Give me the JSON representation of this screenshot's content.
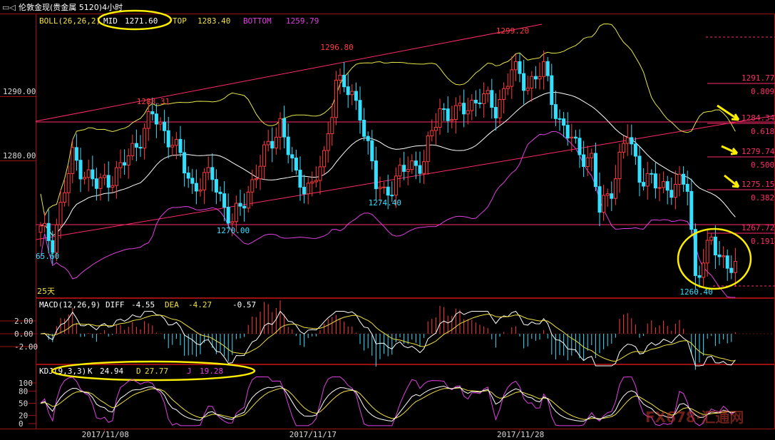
{
  "colors": {
    "up": "#ff3b3b",
    "down": "#33e0ff",
    "mid": "#ffffff",
    "band": "#e6e64a",
    "bottom": "#e040e0",
    "trend": "#ff2a6a",
    "fib": "#ff2a6a",
    "grid": "#8b1010",
    "axis": "#9a0f0f",
    "highlight": "#ffee00",
    "kdj_k": "#ffffff",
    "kdj_d": "#f0e040",
    "kdj_j": "#e040e0",
    "tick": "#d8d8d8"
  },
  "header": {
    "title": "伦敦金现(贵金属 5120)4小时"
  },
  "boll": {
    "label": "BOLL(26,26,2)",
    "mid_label": "MID",
    "mid_value": "1271.60",
    "top_label": "TOP",
    "top_value": "1283.40",
    "bottom_label": "BOTTOM",
    "bottom_value": "1259.79"
  },
  "macd": {
    "label": "MACD(12,26,9)",
    "diff_label": "DIFF",
    "diff_value": "-4.55",
    "dea_label": "DEA",
    "dea_value": "-4.27",
    "macd_value": "-0.57"
  },
  "kdj": {
    "label": "KDJ(9,3,3)",
    "k_label": "K",
    "k_value": "24.94",
    "d_label": "D",
    "d_value": "27.77",
    "j_label": "J",
    "j_value": "19.28"
  },
  "period_label": "25天",
  "chart_data": {
    "type": "candlestick",
    "price_axis": {
      "ticks": [
        "1290.00",
        "1280.00"
      ]
    },
    "macd_axis": {
      "ticks": [
        "2.00",
        "0.00",
        "-2.00"
      ]
    },
    "kdj_axis": {
      "ticks": [
        "100",
        "80",
        "50",
        "20",
        "0"
      ]
    },
    "date_labels": [
      {
        "index": 16,
        "label": "2017/11/08"
      },
      {
        "index": 68,
        "label": "2017/11/17"
      },
      {
        "index": 120,
        "label": "2017/11/28"
      }
    ],
    "price_annotations": [
      {
        "index": 1,
        "value": "65.60",
        "color": "down"
      },
      {
        "index": 28,
        "value": "1288.31",
        "color": "up"
      },
      {
        "index": 48,
        "value": "1270.00",
        "color": "down"
      },
      {
        "index": 74,
        "value": "1296.80",
        "color": "up"
      },
      {
        "index": 86,
        "value": "1274.40",
        "color": "down"
      },
      {
        "index": 118,
        "value": "1299.20",
        "color": "up"
      },
      {
        "index": 164,
        "value": "1260.40",
        "color": "down"
      }
    ],
    "fib_levels": [
      {
        "price": "1291.77",
        "ratio": "0.809"
      },
      {
        "price": "1284.34",
        "ratio": "0.618"
      },
      {
        "price": "1279.74",
        "ratio": "0.500"
      },
      {
        "price": "1275.15",
        "ratio": "0.382"
      },
      {
        "price": "1267.72",
        "ratio": "0.191"
      }
    ]
  }
}
